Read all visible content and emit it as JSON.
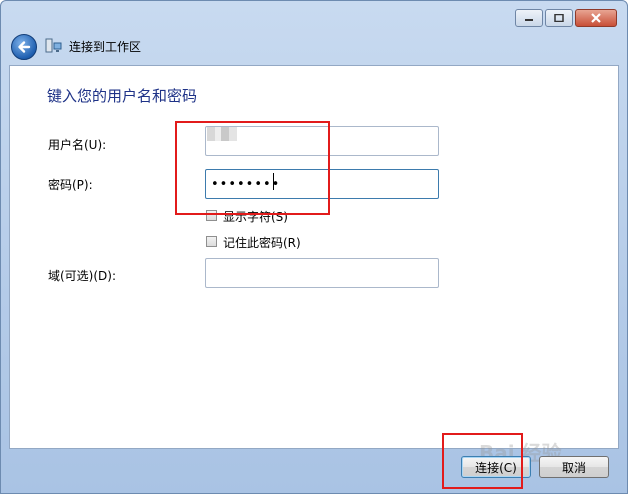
{
  "window": {
    "title": "连接到工作区",
    "buttons": [
      "minimize",
      "maximize",
      "close"
    ]
  },
  "form": {
    "heading": "键入您的用户名和密码",
    "username_label": "用户名(U):",
    "password_label": "密码(P):",
    "password_value": "••••••••",
    "show_chars_label": "显示字符(S)",
    "remember_label": "记住此密码(R)",
    "domain_label": "域(可选)(D):",
    "domain_value": ""
  },
  "footer": {
    "connect_label": "连接(C)",
    "cancel_label": "取消"
  },
  "watermark": "Bai 经验",
  "colors": {
    "heading": "#1e3287",
    "annotation": "#e21b1b"
  }
}
